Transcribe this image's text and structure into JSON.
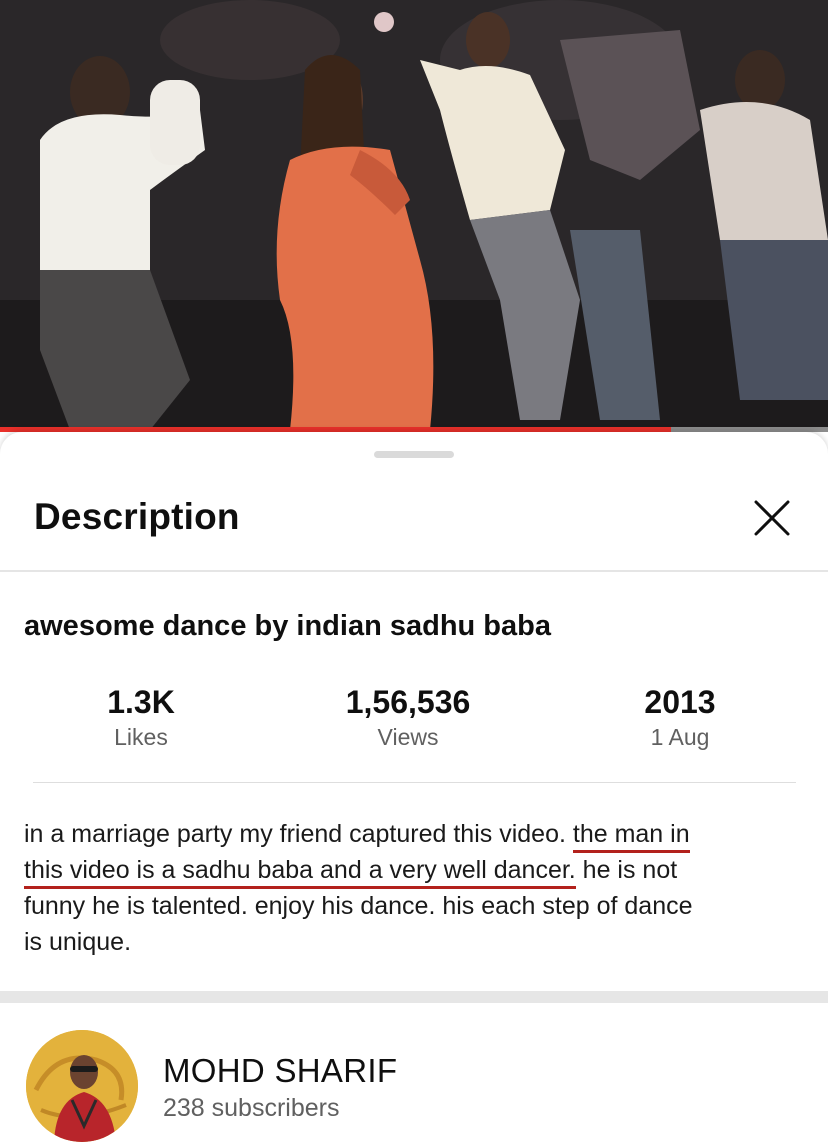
{
  "player": {
    "progress_fraction": 0.81
  },
  "sheet": {
    "title": "Description",
    "close_icon": "close-icon"
  },
  "video": {
    "title": "awesome dance by indian sadhu baba",
    "stats": {
      "likes_value": "1.3K",
      "likes_label": "Likes",
      "views_value": "1,56,536",
      "views_label": "Views",
      "year": "2013",
      "date": "1 Aug"
    },
    "description_lines": [
      {
        "plain": "in a marriage party my friend captured this video. ",
        "underlined": "the man in",
        "rest": ""
      },
      {
        "plain": "",
        "underlined": "this video is a sadhu baba and a very well dancer.",
        "rest": " he is not"
      },
      {
        "plain": "funny he is talented. enjoy his dance. his each step of dance",
        "underlined": "",
        "rest": ""
      },
      {
        "plain": "is unique.",
        "underlined": "",
        "rest": ""
      }
    ]
  },
  "channel": {
    "name": "MOHD SHARIF",
    "subscribers": "238 subscribers"
  },
  "colors": {
    "progress_red": "#e9302a",
    "annotation_underline": "#b3211c",
    "secondary_text": "#606060"
  }
}
